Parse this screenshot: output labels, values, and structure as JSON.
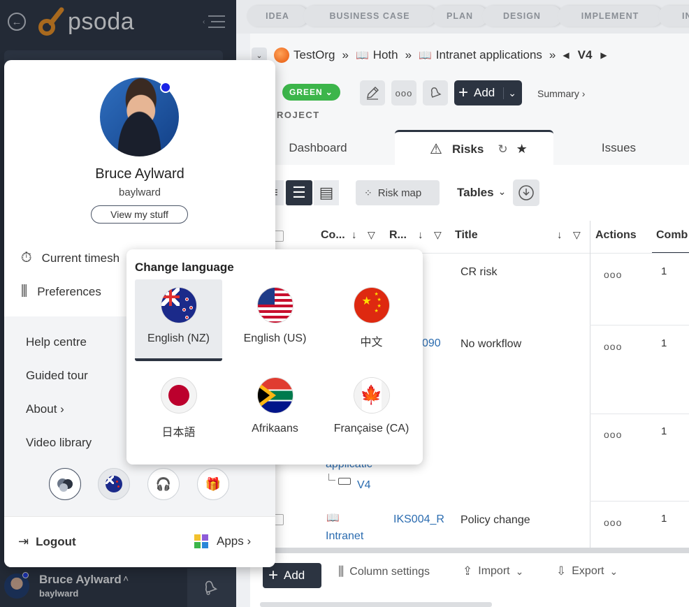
{
  "app": {
    "logo_text": "psoda",
    "brand_color": "#f7941d"
  },
  "stages": [
    "IDEA",
    "BUSINESS CASE",
    "PLAN",
    "DESIGN",
    "IMPLEMENT",
    "IN"
  ],
  "breadcrumb": {
    "org": "TestOrg",
    "items": [
      "Hoth",
      "Intranet applications"
    ],
    "version": "V4"
  },
  "toolbar": {
    "status": "GREEN",
    "add_label": "Add",
    "summary_label": "Summary ›",
    "project_label": "ROJECT"
  },
  "tabs": {
    "dashboard": "Dashboard",
    "risks": "Risks",
    "issues": "Issues"
  },
  "view": {
    "risk_map": "Risk map",
    "tables": "Tables"
  },
  "table": {
    "headers": {
      "code": "Co...",
      "ref": "R...",
      "title": "Title",
      "actions": "Actions",
      "comb": "Comb"
    },
    "rows": [
      {
        "ref": "",
        "title": "CR risk",
        "comb": "1"
      },
      {
        "ref": "090",
        "title": "No workflow",
        "comb": "1"
      },
      {
        "ref": "",
        "title": "",
        "comb": "1",
        "code_link": "applicatic",
        "version": "V4"
      },
      {
        "ref": "IKS004_R",
        "title": "Policy change",
        "comb": "1",
        "code_link": "Intranet"
      }
    ],
    "actions_glyph": "ooo"
  },
  "bottom": {
    "add": "Add",
    "column_settings": "Column settings",
    "import": "Import",
    "export": "Export"
  },
  "profile": {
    "name": "Bruce Aylward",
    "username": "baylward",
    "view_stuff": "View my stuff",
    "menu": {
      "timesheet": "Current timesh",
      "preferences": "Preferences"
    },
    "help": [
      "Help centre",
      "Guided tour",
      "About ›",
      "Video library"
    ],
    "logout": "Logout",
    "apps": "Apps ›"
  },
  "language": {
    "title": "Change language",
    "options": [
      "English (NZ)",
      "English (US)",
      "中文",
      "日本語",
      "Afrikaans",
      "Française (CA)"
    ],
    "selected": "English (NZ)"
  },
  "footer_user": {
    "name": "Bruce Aylward",
    "username": "baylward"
  }
}
